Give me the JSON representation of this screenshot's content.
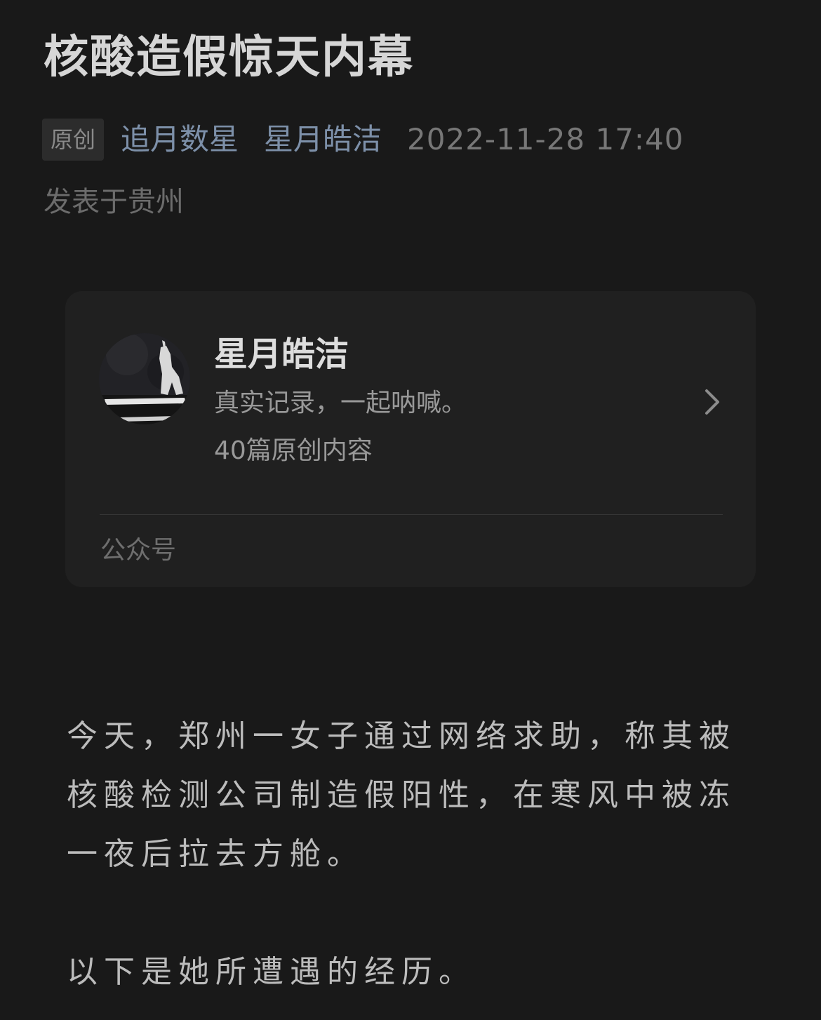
{
  "article": {
    "title": "核酸造假惊天内幕",
    "badge": "原创",
    "author": "追月数星",
    "account_link": "星月皓洁",
    "datetime": "2022-11-28 17:40",
    "location": "发表于贵州"
  },
  "account_card": {
    "name": "星月皓洁",
    "description": "真实记录，一起呐喊。",
    "original_count": "40篇原创内容",
    "footer_label": "公众号",
    "avatar_icon": "account-avatar",
    "chevron_icon": "chevron-right-icon"
  },
  "body": {
    "paragraphs": [
      "今天，郑州一女子通过网络求助，称其被核酸检测公司制造假阳性，在寒风中被冻一夜后拉去方舱。",
      "以下是她所遭遇的经历。"
    ]
  },
  "colors": {
    "background": "#191919",
    "link": "#7d90a9",
    "card": "#202020"
  }
}
